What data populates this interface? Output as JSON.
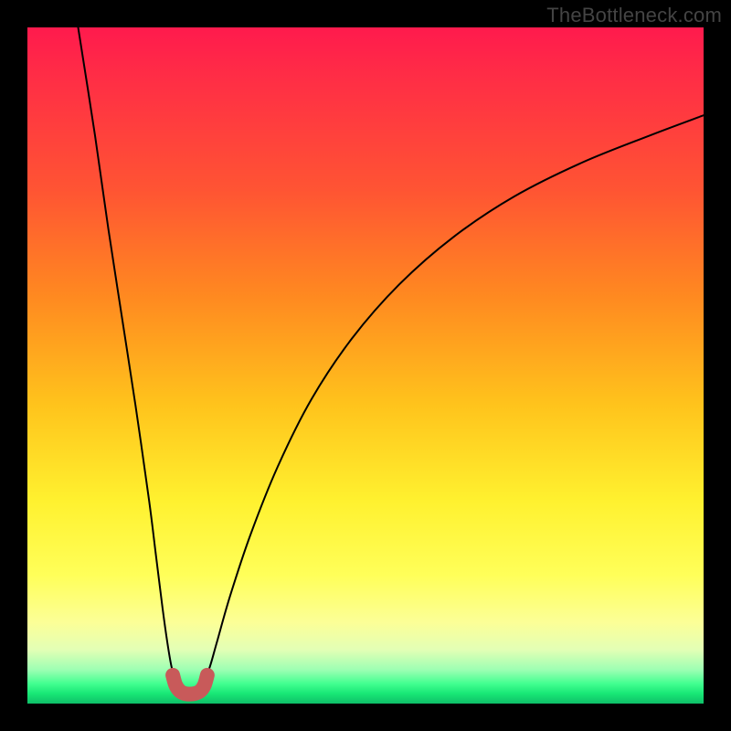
{
  "watermark": "TheBottleneck.com",
  "chart_data": {
    "type": "line",
    "title": "",
    "xlabel": "",
    "ylabel": "",
    "xlim": [
      0,
      100
    ],
    "ylim": [
      0,
      100
    ],
    "background_gradient": {
      "top": "#ff1a4d",
      "mid_upper": "#ff8a20",
      "mid": "#fff12f",
      "mid_lower": "#fcff97",
      "bottom": "#0fbf68"
    },
    "series": [
      {
        "name": "bottleneck-curve-left",
        "stroke": "#000000",
        "x": [
          7.5,
          10,
          12,
          14,
          16,
          18,
          19,
          20,
          20.7,
          21.3,
          21.9
        ],
        "y": [
          100,
          84,
          70,
          57,
          44,
          30,
          22,
          14,
          9,
          5.5,
          3.5
        ]
      },
      {
        "name": "bottleneck-curve-right",
        "stroke": "#000000",
        "x": [
          26.2,
          27,
          28,
          30,
          33,
          37,
          42,
          48,
          55,
          63,
          72,
          82,
          92,
          100
        ],
        "y": [
          3.5,
          5.5,
          9,
          16,
          25,
          35,
          45,
          54,
          62,
          69,
          75,
          80,
          84,
          87
        ]
      },
      {
        "name": "valley-marker",
        "stroke": "#c85a5a",
        "thick": true,
        "x": [
          21.5,
          21.9,
          22.5,
          23.2,
          24.0,
          24.8,
          25.6,
          26.2,
          26.6
        ],
        "y": [
          4.2,
          2.8,
          1.9,
          1.5,
          1.4,
          1.5,
          1.9,
          2.8,
          4.2
        ]
      }
    ]
  }
}
